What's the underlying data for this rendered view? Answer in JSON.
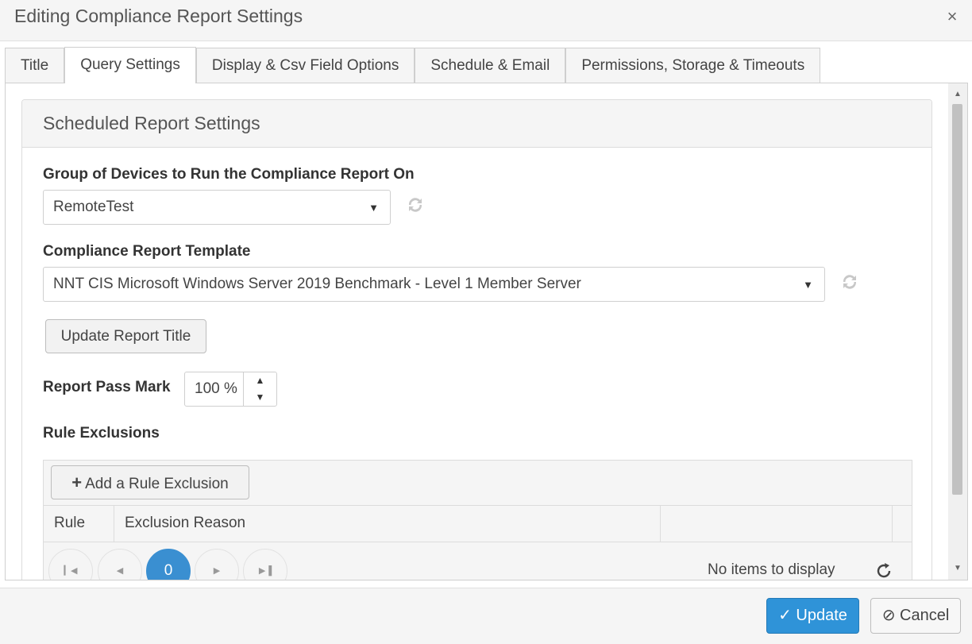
{
  "dialog": {
    "title": "Editing Compliance Report Settings",
    "close_symbol": "×"
  },
  "tabs": [
    {
      "label": "Title",
      "active": false
    },
    {
      "label": "Query Settings",
      "active": true
    },
    {
      "label": "Display & Csv Field Options",
      "active": false
    },
    {
      "label": "Schedule & Email",
      "active": false
    },
    {
      "label": "Permissions, Storage & Timeouts",
      "active": false
    }
  ],
  "panel": {
    "heading": "Scheduled Report Settings",
    "group_label": "Group of Devices to Run the Compliance Report On",
    "group_value": "RemoteTest",
    "template_label": "Compliance Report Template",
    "template_value": "NNT CIS Microsoft Windows Server 2019 Benchmark - Level 1 Member Server",
    "update_title_button": "Update Report Title",
    "pass_mark_label": "Report Pass Mark",
    "pass_mark_value": "100 %",
    "exclusions_label": "Rule Exclusions"
  },
  "grid": {
    "add_button": "Add a Rule Exclusion",
    "columns": [
      "Rule",
      "Exclusion Reason",
      ""
    ],
    "current_page": "0",
    "info": "No items to display"
  },
  "footer": {
    "update_label": "Update",
    "cancel_label": "Cancel"
  },
  "colors": {
    "primary": "#2f93d8",
    "pager_active": "#3a8fd1"
  },
  "icons": {
    "refresh": "refresh-icon",
    "dropdown": "chevron-down-icon",
    "add": "plus-icon",
    "check": "check-icon",
    "cancel": "ban-icon"
  }
}
